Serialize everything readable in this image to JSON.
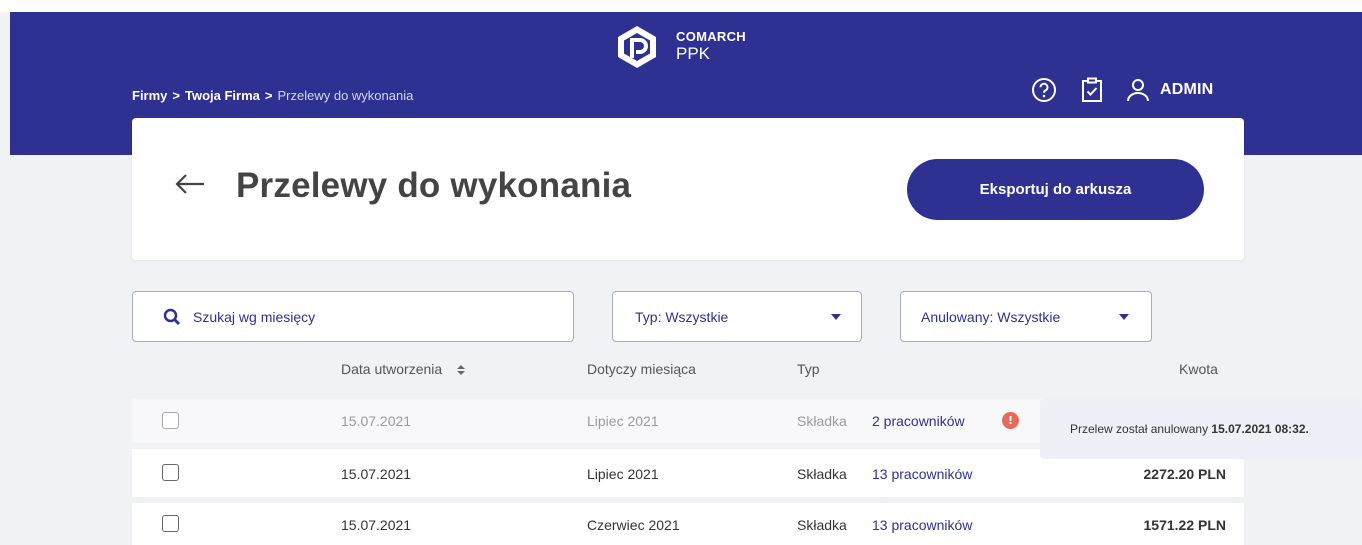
{
  "brand": {
    "top": "COMARCH",
    "bottom": "PPK"
  },
  "breadcrumb": {
    "item1": "Firmy",
    "sep1": ">",
    "item2": "Twoja Firma",
    "sep2": ">",
    "current": "Przelewy do wykonania"
  },
  "header": {
    "help_icon": "help-circle-icon",
    "tasks_icon": "clipboard-check-icon",
    "user_icon": "user-icon",
    "user_label": "ADMIN"
  },
  "page": {
    "title": "Przelewy do wykonania",
    "export_label": "Eksportuj do arkusza"
  },
  "filters": {
    "search_placeholder": "Szukaj wg miesięcy",
    "type_select": "Typ: Wszystkie",
    "cancelled_select": "Anulowany: Wszystkie"
  },
  "table": {
    "columns": {
      "date": "Data utworzenia",
      "month": "Dotyczy miesiąca",
      "type": "Typ",
      "amount": "Kwota"
    },
    "rows": [
      {
        "date": "15.07.2021",
        "month": "Lipiec 2021",
        "type": "Składka",
        "employees": "2 pracowników",
        "amount": "",
        "cancelled": true
      },
      {
        "date": "15.07.2021",
        "month": "Lipiec 2021",
        "type": "Składka",
        "employees": "13 pracowników",
        "amount": "2272.20 PLN",
        "cancelled": false
      },
      {
        "date": "15.07.2021",
        "month": "Czerwiec 2021",
        "type": "Składka",
        "employees": "13 pracowników",
        "amount": "1571.22 PLN",
        "cancelled": false
      }
    ]
  },
  "tooltip": {
    "text": "Przelew został anulowany",
    "datetime": "15.07.2021 08:32."
  },
  "colors": {
    "primary": "#2e3192",
    "background": "#f1f2f6",
    "alert": "#e8685a"
  }
}
